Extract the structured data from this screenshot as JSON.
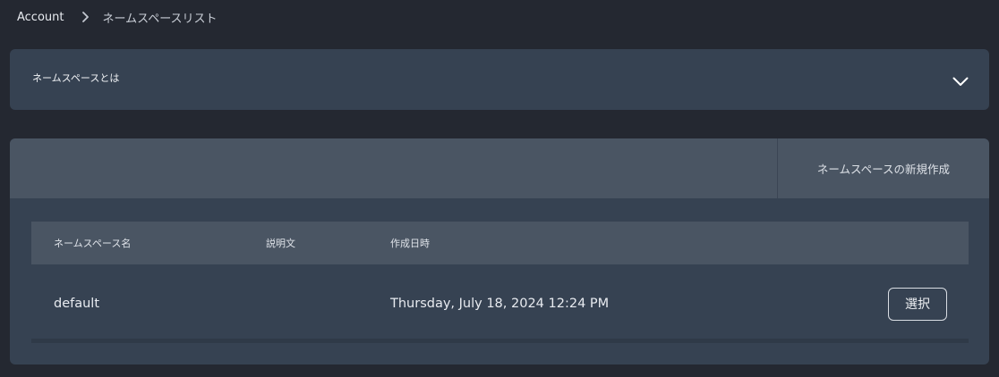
{
  "breadcrumb": {
    "items": [
      {
        "label": "Account"
      },
      {
        "label": "ネームスペースリスト"
      }
    ]
  },
  "accordion": {
    "title": "ネームスペースとは",
    "expanded": false
  },
  "panel": {
    "create_label": "ネームスペースの新規作成"
  },
  "table": {
    "headers": [
      "ネームスペース名",
      "説明文",
      "作成日時"
    ],
    "rows": [
      {
        "name": "default",
        "description": "",
        "created": "Thursday, July 18, 2024 12:24 PM",
        "action_label": "選択"
      }
    ]
  },
  "colors": {
    "background": "#242831",
    "card": "#364252",
    "header": "#4a5563"
  }
}
